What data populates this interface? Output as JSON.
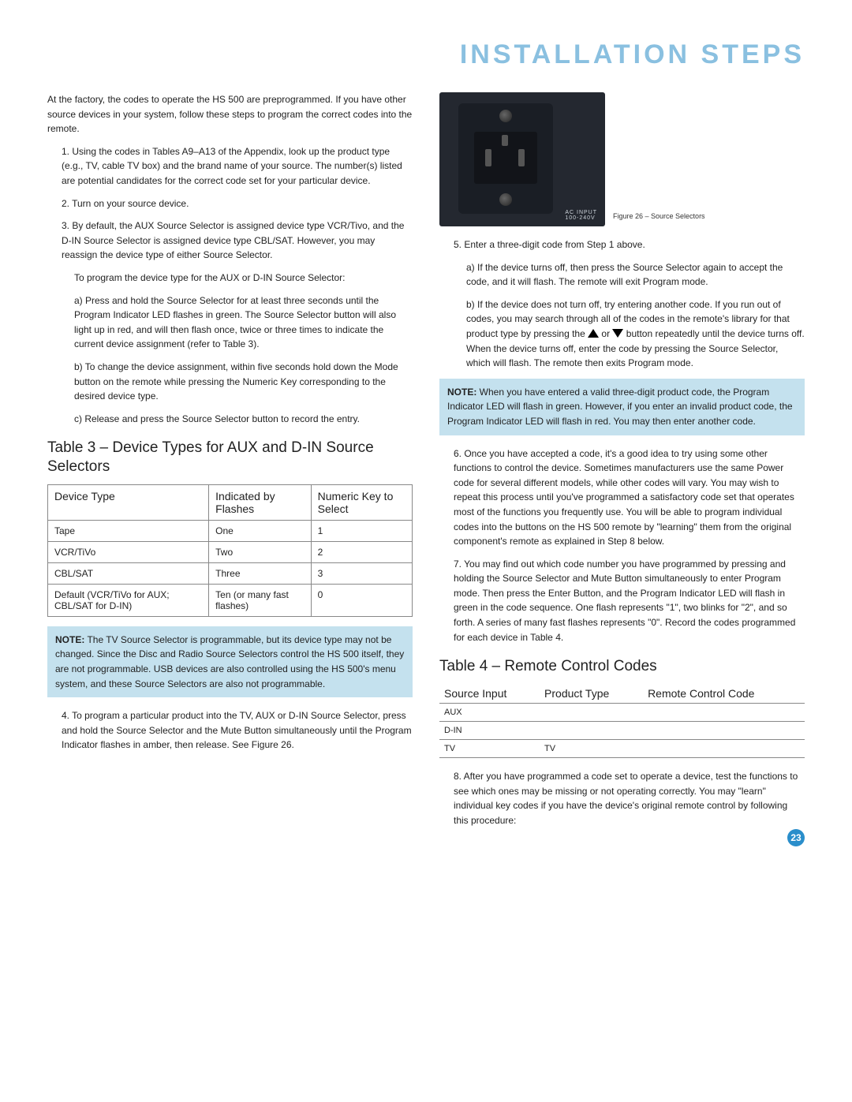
{
  "title": "INSTALLATION STEPS",
  "pageNumber": "23",
  "left": {
    "intro": "At the factory, the codes to operate the HS 500 are preprogrammed. If you have other source devices in your system, follow these steps to program the correct codes into the remote.",
    "step1": "1. Using the codes in Tables A9–A13 of the Appendix, look up the product type (e.g., TV, cable TV box) and the brand name of your source. The number(s) listed are potential candidates for the correct code set for your particular device.",
    "step2": "2. Turn on your source device.",
    "step3": "3. By default, the AUX Source Selector is assigned device type VCR/Tivo, and the D-IN Source Selector is assigned device type CBL/SAT. However, you may reassign the device type of either Source Selector.",
    "step3b": "To program the device type for the AUX or D-IN Source Selector:",
    "step3c": "a) Press and hold the Source Selector for at least three seconds until the Program Indicator LED flashes in green. The Source Selector button will also light up in red, and will then flash once, twice or three times to indicate the current device assignment (refer to Table 3).",
    "step3d": "b) To change the device assignment, within five seconds hold down the Mode button on the remote while pressing the Numeric Key corresponding to the desired device type.",
    "step3e": "c) Release and press the Source Selector button to record the entry.",
    "t3title": "Table 3 – Device Types for AUX and D-IN Source Selectors",
    "t3headers": {
      "c1": "Device Type",
      "c2": "Indicated by Flashes",
      "c3": "Numeric Key to Select"
    },
    "t3rows": [
      {
        "c1": "Tape",
        "c2": "One",
        "c3": "1"
      },
      {
        "c1": "VCR/TiVo",
        "c2": "Two",
        "c3": "2"
      },
      {
        "c1": "CBL/SAT",
        "c2": "Three",
        "c3": "3"
      },
      {
        "c1": "Default (VCR/TiVo for AUX; CBL/SAT for D-IN)",
        "c2": "Ten (or many fast flashes)",
        "c3": "0"
      }
    ],
    "note1label": "NOTE:",
    "note1": " The TV Source Selector is programmable, but its device type may not be changed. Since the Disc and Radio Source Selectors control the HS 500 itself, they are not programmable. USB devices are also controlled using the HS 500's menu system, and these Source Selectors are also not programmable.",
    "step4": "4. To program a particular product into the TV, AUX or D-IN Source Selector, press and hold the Source Selector and the Mute Button simultaneously until the Program Indicator flashes in amber, then release. See Figure 26."
  },
  "right": {
    "figlabel1": "AC INPUT",
    "figlabel2": "100-240V",
    "figcaption": "Figure 26 – Source Selectors",
    "step5": "5. Enter a three-digit code from Step 1 above.",
    "step5a": "a) If the device turns off, then press the Source Selector again to accept the code, and it will flash. The remote will exit Program mode.",
    "step5b_a": "b) If the device does not turn off, try entering another code. If you run out of codes, you may search through all of the codes in the remote's library for that product type by pressing the ",
    "or": " or ",
    "step5b_b": " button repeatedly until the device turns off. When the device turns off, enter the code by pressing the Source Selector, which will flash. The remote then exits Program mode.",
    "note2label": "NOTE:",
    "note2": " When you have entered a valid three-digit product code, the Program Indicator LED will flash in green. However, if you enter an invalid product code, the Program Indicator LED will flash in red. You may then enter another code.",
    "step6": "6. Once you have accepted a code, it's a good idea to try using some other functions to control the device. Sometimes manufacturers use the same Power code for several different models, while other codes will vary. You may wish to repeat this process until you've programmed a satisfactory code set that operates most of the functions you frequently use. You will be able to program individual codes into the buttons on the HS 500 remote by \"learning\" them from the original component's remote as explained in Step 8 below.",
    "step7": "7. You may find out which code number you have programmed by pressing and holding the Source Selector and Mute Button simultaneously to enter Program mode. Then press the Enter Button, and the Program Indicator LED will flash in green in the code sequence. One flash represents \"1\", two blinks for \"2\", and so forth. A series of many fast flashes represents \"0\". Record the codes programmed for each device in Table 4.",
    "t4title": "Table 4 – Remote Control Codes",
    "t4headers": {
      "c1": "Source Input",
      "c2": "Product Type",
      "c3": "Remote Control Code"
    },
    "t4rows": [
      {
        "c1": "AUX",
        "c2": "",
        "c3": ""
      },
      {
        "c1": "D-IN",
        "c2": "",
        "c3": ""
      },
      {
        "c1": "TV",
        "c2": "TV",
        "c3": ""
      }
    ],
    "step8": "8. After you have programmed a code set to operate a device, test the functions to see which ones may be missing or not operating correctly. You may \"learn\" individual key codes if you have the device's original remote control by following this procedure:"
  },
  "chart_data": [
    {
      "type": "table",
      "title": "Table 3 – Device Types for AUX and D-IN Source Selectors",
      "columns": [
        "Device Type",
        "Indicated by Flashes",
        "Numeric Key to Select"
      ],
      "rows": [
        [
          "Tape",
          "One",
          "1"
        ],
        [
          "VCR/TiVo",
          "Two",
          "2"
        ],
        [
          "CBL/SAT",
          "Three",
          "3"
        ],
        [
          "Default (VCR/TiVo for AUX; CBL/SAT for D-IN)",
          "Ten (or many fast flashes)",
          "0"
        ]
      ]
    },
    {
      "type": "table",
      "title": "Table 4 – Remote Control Codes",
      "columns": [
        "Source Input",
        "Product Type",
        "Remote Control Code"
      ],
      "rows": [
        [
          "AUX",
          "",
          ""
        ],
        [
          "D-IN",
          "",
          ""
        ],
        [
          "TV",
          "TV",
          ""
        ]
      ]
    }
  ]
}
